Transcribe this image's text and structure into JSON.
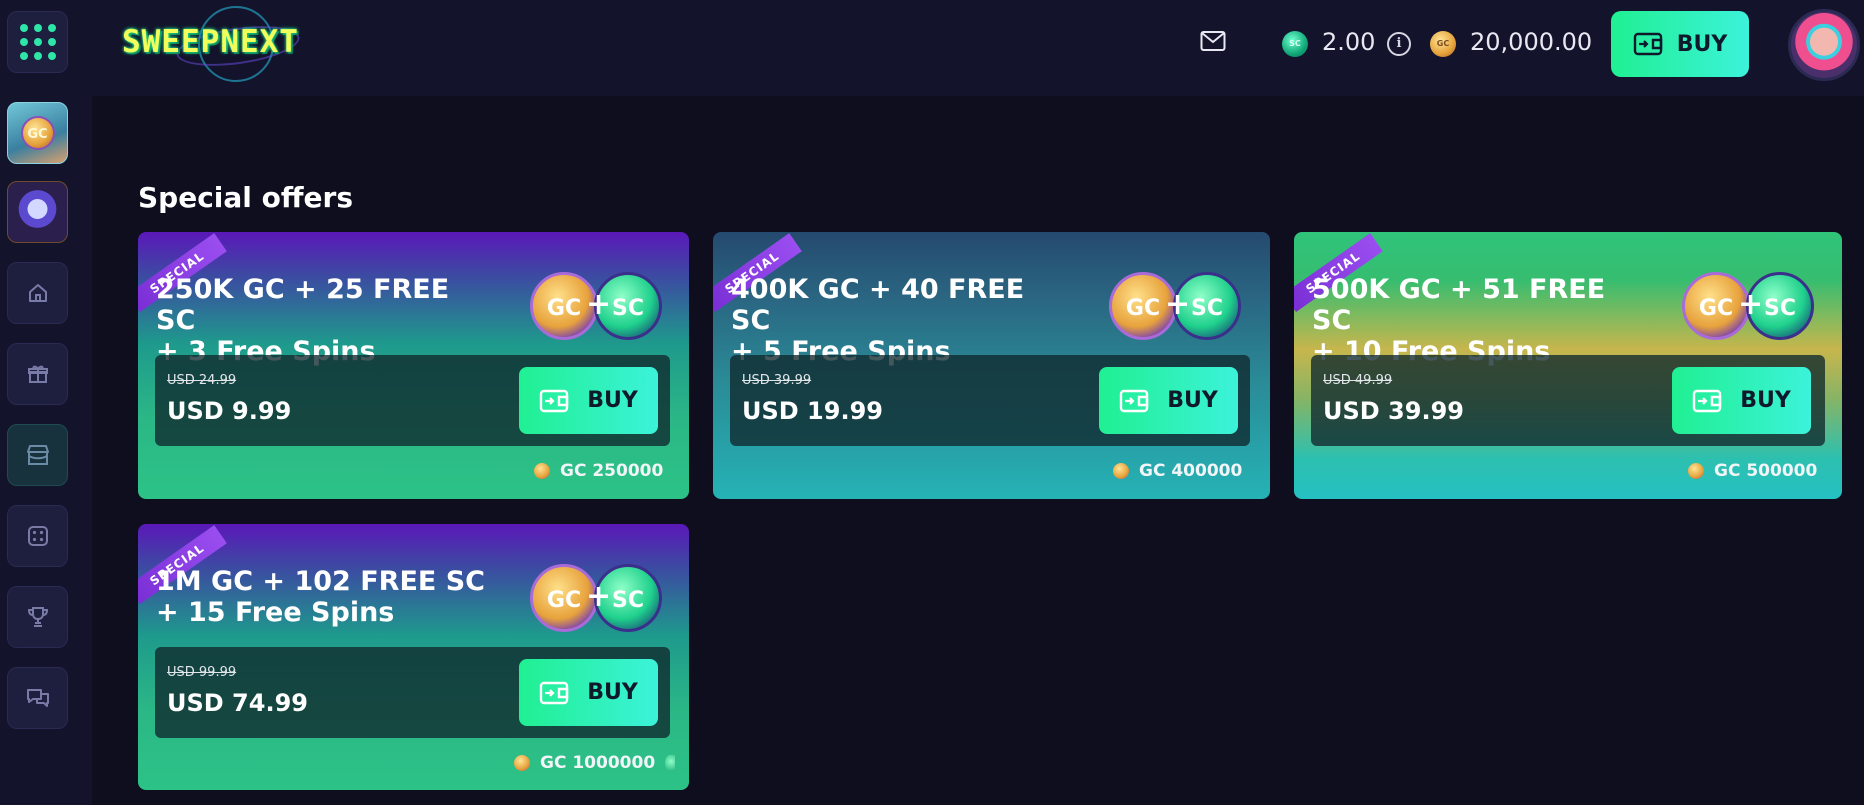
{
  "header": {
    "brand": "SWEEPNEXT",
    "sc_coin_label": "SC",
    "sc_balance": "2.00",
    "gc_coin_label": "GC",
    "gc_balance": "20,000.00",
    "buy_label": "BUY",
    "icons": [
      "grid-menu-icon",
      "mail-icon",
      "info-icon",
      "wallet-icon",
      "avatar"
    ]
  },
  "sidebar": {
    "items": [
      {
        "name": "gold-coin-promo",
        "label": "GC"
      },
      {
        "name": "prize-wheel-promo"
      },
      {
        "name": "home-icon"
      },
      {
        "name": "gift-icon"
      },
      {
        "name": "store-icon",
        "active": true
      },
      {
        "name": "dice-icon"
      },
      {
        "name": "trophy-icon"
      },
      {
        "name": "chat-icon"
      }
    ]
  },
  "main": {
    "section_title": "Special offers",
    "offers": [
      {
        "ribbon": "SPECIAL",
        "title_line1": "250K GC + 25 FREE SC",
        "title_line2": "+ 3 Free Spins",
        "old_price": "USD 24.99",
        "price": "USD 9.99",
        "buy_label": "BUY",
        "gc_amount": "GC 250000",
        "coin_gc": "GC",
        "coin_plus": "+",
        "coin_sc": "SC"
      },
      {
        "ribbon": "SPECIAL",
        "title_line1": "400K GC + 40 FREE SC",
        "title_line2": "+ 5 Free Spins",
        "old_price": "USD 39.99",
        "price": "USD 19.99",
        "buy_label": "BUY",
        "gc_amount": "GC 400000",
        "coin_gc": "GC",
        "coin_plus": "+",
        "coin_sc": "SC"
      },
      {
        "ribbon": "SPECIAL",
        "title_line1": "500K GC + 51 FREE SC",
        "title_line2": "+ 10 Free Spins",
        "old_price": "USD 49.99",
        "price": "USD 39.99",
        "buy_label": "BUY",
        "gc_amount": "GC 500000",
        "coin_gc": "GC",
        "coin_plus": "+",
        "coin_sc": "SC"
      },
      {
        "ribbon": "SPECIAL",
        "title_line1": "1M GC + 102 FREE SC",
        "title_line2": "+ 15 Free Spins",
        "old_price": "USD 99.99",
        "price": "USD 74.99",
        "buy_label": "BUY",
        "gc_amount": "GC 1000000",
        "coin_gc": "GC",
        "coin_plus": "+",
        "coin_sc": "SC"
      }
    ]
  },
  "colors": {
    "background": "#0f0e1f",
    "header": "#13132b",
    "accent_green": "#20f092",
    "accent_cyan": "#3cf2da",
    "ribbon_purple": "#7a2fd6"
  }
}
